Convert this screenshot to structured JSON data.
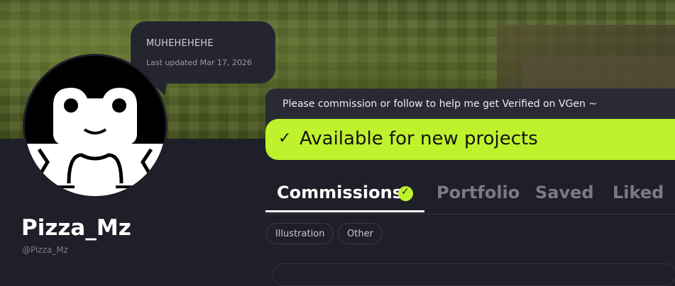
{
  "profile": {
    "status_message": "MUHEHEHEHE",
    "last_updated": "Last updated Mar 17, 2026",
    "display_name": "Pizza_Mz",
    "handle": "@Pizza_Mz"
  },
  "cta": {
    "message": "Please commission or follow to help me get Verified on VGen ~",
    "availability": "Available for new projects",
    "check_icon": "✓"
  },
  "tabs": [
    {
      "label": "Commissions",
      "active": true
    },
    {
      "label": "Portfolio",
      "active": false
    },
    {
      "label": "Saved",
      "active": false
    },
    {
      "label": "Liked",
      "active": false
    }
  ],
  "filters": [
    "Illustration",
    "Other"
  ],
  "colors": {
    "accent": "#bef22d",
    "background": "#1f1f2a"
  }
}
